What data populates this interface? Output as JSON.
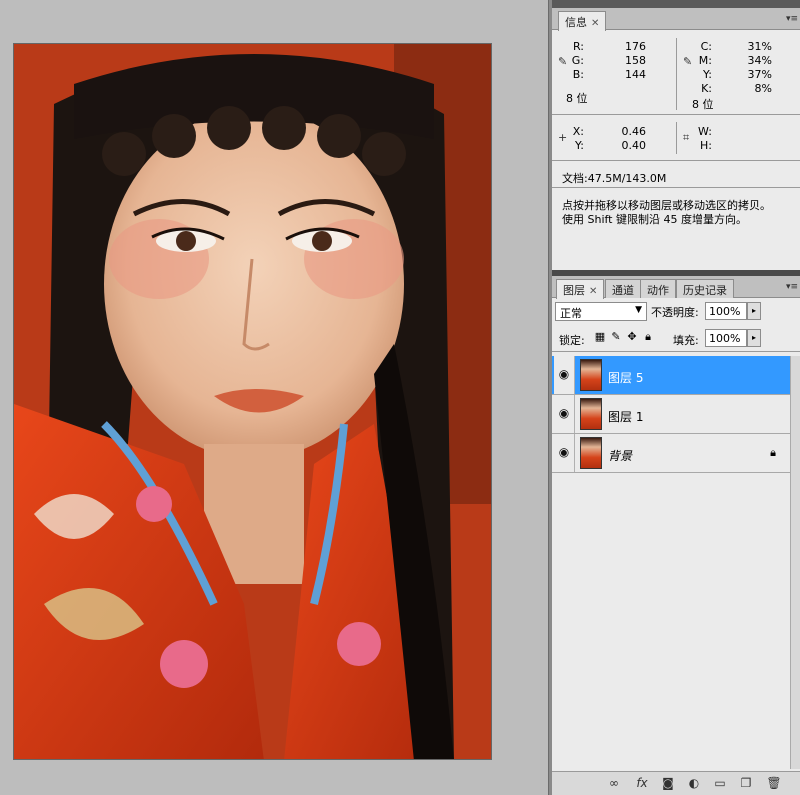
{
  "info_panel": {
    "tab_label": "信息",
    "rgb": [
      {
        "label": "R:",
        "value": "176"
      },
      {
        "label": "G:",
        "value": "158"
      },
      {
        "label": "B:",
        "value": "144"
      }
    ],
    "rgb_bit_depth": "8 位",
    "cmyk": [
      {
        "label": "C:",
        "value": "31%"
      },
      {
        "label": "M:",
        "value": "34%"
      },
      {
        "label": "Y:",
        "value": "37%"
      },
      {
        "label": "K:",
        "value": "8%"
      }
    ],
    "cmyk_bit_depth": "8 位",
    "xy": [
      {
        "label": "X:",
        "value": "0.46"
      },
      {
        "label": "Y:",
        "value": "0.40"
      }
    ],
    "wh": [
      {
        "label": "W:",
        "value": ""
      },
      {
        "label": "H:",
        "value": ""
      }
    ],
    "doc_size": "文档:47.5M/143.0M",
    "hint_line1": "点按并拖移以移动图层或移动选区的拷贝。",
    "hint_line2": "使用 Shift 键限制沿 45 度增量方向。"
  },
  "layers_panel": {
    "tabs": [
      {
        "label": "图层",
        "active": true
      },
      {
        "label": "通道",
        "active": false
      },
      {
        "label": "动作",
        "active": false
      },
      {
        "label": "历史记录",
        "active": false
      }
    ],
    "blend_mode": "正常",
    "opacity_label": "不透明度:",
    "opacity_value": "100%",
    "lock_label": "锁定:",
    "fill_label": "填充:",
    "fill_value": "100%",
    "layers": [
      {
        "name": "图层 5",
        "selected": true,
        "locked": false
      },
      {
        "name": "图层 1",
        "selected": false,
        "locked": false
      },
      {
        "name": "背景",
        "selected": false,
        "locked": true
      }
    ]
  },
  "icons": {
    "eye": "eye-icon",
    "lock": "lock-icon",
    "link": "link-icon",
    "fx": "fx-icon",
    "mask": "mask-icon",
    "adjustment": "adjustment-icon",
    "folder": "folder-icon",
    "new_layer": "new-layer-icon",
    "trash": "trash-icon"
  },
  "colors": {
    "selection": "#3399ff",
    "panel_bg": "#ebebeb",
    "canvas_bg": "#bdbdbd"
  }
}
